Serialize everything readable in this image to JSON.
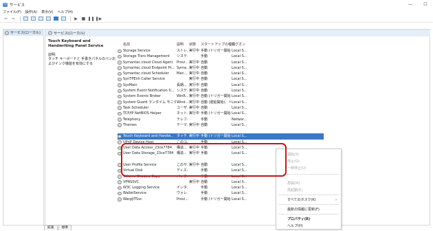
{
  "window": {
    "title": "サービス",
    "controls": [
      "—",
      "☐"
    ]
  },
  "menu": [
    "ファイル(F)",
    "操作(A)",
    "表示(V)",
    "ヘルプ(H)"
  ],
  "toolbar_glyphs": {
    "back": "⇦",
    "forward": "⇨",
    "play": "▶",
    "stop": "■",
    "pause": "❚❚",
    "restart": "❚▶"
  },
  "tree": {
    "root_label": "サービス(ローカル)"
  },
  "main": {
    "header": "サービス(ローカル)",
    "detail": {
      "service_name": "Touch Keyboard and Handwriting Panel Service",
      "desc_label": "説明:",
      "desc_text": "タッチ キーボードと 手書きパネルのペンおよびインク機能を有効にする"
    },
    "columns": {
      "name": "名前",
      "desc": "説明",
      "status": "状態",
      "startup": "スタートアップの種類",
      "logon": "ログオン"
    },
    "rows": [
      {
        "name": "Storage Service",
        "desc": "ストレ...",
        "status": "実行中",
        "startup": "手動 (トリガー開始)",
        "logon": "Local S..."
      },
      {
        "name": "Storage Tiers Management",
        "desc": "システ...",
        "status": "",
        "startup": "手動",
        "logon": "Local S..."
      },
      {
        "name": "Symantec.cloud Cloud Agent",
        "desc": "Provi...",
        "status": "実行中",
        "startup": "自動",
        "logon": "Local S..."
      },
      {
        "name": "Symantec.cloud Endpoint Pr...",
        "desc": "Syma...",
        "status": "実行中",
        "startup": "自動",
        "logon": "Local S..."
      },
      {
        "name": "Symantec.cloud Scheduler",
        "desc": "Man...",
        "status": "実行中",
        "startup": "自動",
        "logon": "Local S..."
      },
      {
        "name": "SynTPEnh Caller Service",
        "desc": "",
        "status": "実行中",
        "startup": "自動",
        "logon": "Local S..."
      },
      {
        "name": "SysMain",
        "desc": "長期...",
        "status": "実行中",
        "startup": "自動",
        "logon": "Local S..."
      },
      {
        "name": "System Event Notification S...",
        "desc": "システ...",
        "status": "実行中",
        "startup": "自動",
        "logon": "Local S..."
      },
      {
        "name": "System Events Broker",
        "desc": "WinR...",
        "status": "実行中",
        "startup": "自動 (トリガー開始)",
        "logon": "Local S..."
      },
      {
        "name": "System Guard ランタイム モニタ...",
        "desc": "Wind...",
        "status": "実行中",
        "startup": "自動 (遅延開始)、ト...",
        "logon": "Local S..."
      },
      {
        "name": "Task Scheduler",
        "desc": "ユーザ...",
        "status": "実行中",
        "startup": "自動",
        "logon": "Local S..."
      },
      {
        "name": "TCP/IP NetBIOS Helper",
        "desc": "ネット...",
        "status": "実行中",
        "startup": "手動 (トリガー開始)",
        "logon": "Local S..."
      },
      {
        "name": "Telephony",
        "desc": "テレフ...",
        "status": "",
        "startup": "手動",
        "logon": "Networ..."
      },
      {
        "name": "Themes",
        "desc": "テーマ...",
        "status": "実行中",
        "startup": "自動",
        "logon": "Local S..."
      },
      {
        "name": "",
        "desc": "",
        "status": "",
        "startup": "",
        "logon": ""
      },
      {
        "name": "Touch Keyboard and Handw...",
        "desc": "タッチ...",
        "status": "実行中",
        "startup": "手動 (トリガー開始)",
        "logon": "Local S...",
        "selected": true
      },
      {
        "name": "UPnP Device Host",
        "desc": "このコ...",
        "status": "",
        "startup": "手動",
        "logon": "Local S..."
      },
      {
        "name": "User Data Access_23ce7784",
        "desc": "構造...",
        "status": "実行中",
        "startup": "手動",
        "logon": "Local S..."
      },
      {
        "name": "User Data Storage_23ce7784",
        "desc": "構造...",
        "status": "実行中",
        "startup": "手動",
        "logon": "Local S..."
      },
      {
        "name": "",
        "desc": "",
        "status": "",
        "startup": "",
        "logon": ""
      },
      {
        "name": "User Profile Service",
        "desc": "このサ...",
        "status": "実行中",
        "startup": "自動",
        "logon": "Local S..."
      },
      {
        "name": "Virtual Disk",
        "desc": "ディス...",
        "status": "",
        "startup": "手動",
        "logon": "Local S..."
      },
      {
        "name": "Volume Shadow Copy",
        "desc": "バック...",
        "status": "",
        "startup": "手動",
        "logon": "Local S..."
      },
      {
        "name": "VPNSSVC",
        "desc": "",
        "status": "実行中",
        "startup": "自動",
        "logon": "Local S..."
      },
      {
        "name": "W3C Logging Service",
        "desc": "インタ...",
        "status": "",
        "startup": "手動",
        "logon": "Local S..."
      },
      {
        "name": "WalletService",
        "desc": "ウォレ...",
        "status": "",
        "startup": "手動",
        "logon": "Local S..."
      },
      {
        "name": "WarpJITSvc",
        "desc": "Provi...",
        "status": "",
        "startup": "手動 (トリガー開始)",
        "logon": "Local S..."
      }
    ]
  },
  "context_menu": {
    "items": [
      {
        "label": "開始(S)",
        "disabled": true
      },
      {
        "label": "停止(O)",
        "disabled": true
      },
      {
        "label": "一時停止(U)",
        "disabled": true
      },
      {
        "label": "再開(M)",
        "disabled": true
      },
      {
        "label": "再起動(E)",
        "disabled": true
      },
      {
        "label": "すべてのタスク(K)",
        "arrow": "›"
      },
      {
        "label": "最新の情報に更新(F)"
      },
      {
        "label": "プロパティ(R)",
        "bold": true
      },
      {
        "label": "ヘルプ(H)"
      }
    ]
  },
  "bottom_tabs": [
    "拡張",
    "標準"
  ],
  "colors": {
    "selection": "#3b78c5",
    "highlight": "#c2151f",
    "header": "#e4eef9"
  }
}
